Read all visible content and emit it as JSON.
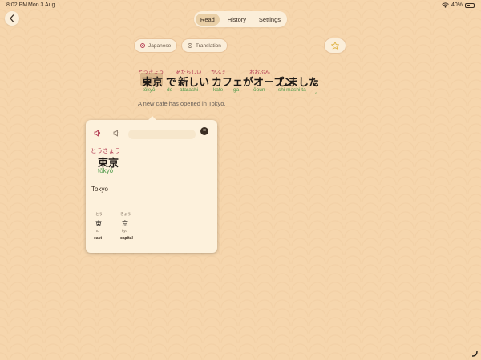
{
  "status_bar": {
    "time": "8:02 PM",
    "date": "Mon 3 Aug",
    "battery": "40%"
  },
  "nav": {
    "tabs": [
      {
        "label": "Read",
        "active": true
      },
      {
        "label": "History",
        "active": false
      },
      {
        "label": "Settings",
        "active": false
      }
    ]
  },
  "toggles": {
    "japanese_label": "Japanese",
    "translation_label": "Translation"
  },
  "sentence": {
    "words": [
      {
        "furigana": "とうきょう",
        "text": "東京",
        "romaji": "tōkyō",
        "selected": true
      },
      {
        "furigana": "",
        "text": "で",
        "romaji": "de"
      },
      {
        "furigana": "あたらしい",
        "text": "新しい",
        "romaji": "atarashi"
      },
      {
        "furigana": "かふぇ",
        "text": "カフェ",
        "romaji": "kafe"
      },
      {
        "furigana": "",
        "text": "が",
        "romaji": "ga"
      },
      {
        "furigana": "おおぷん",
        "text": "オープン",
        "romaji": "ōpun"
      },
      {
        "furigana": "",
        "text": "しました",
        "romaji": "shi mashi ta"
      },
      {
        "furigana": "",
        "text": "。",
        "romaji": "。"
      }
    ],
    "translation": "A new cafe has opened in Tokyo."
  },
  "popover": {
    "furigana": "とうきょう",
    "word": "東京",
    "romaji": "tōkyō",
    "meaning": "Tokyo",
    "kanji": [
      {
        "furigana": "とう",
        "char": "東",
        "romaji": "tō",
        "meaning": "east"
      },
      {
        "furigana": "きょう",
        "char": "京",
        "romaji": "kyō",
        "meaning": "capital"
      }
    ]
  },
  "colors": {
    "background": "#f6d6ad",
    "furigana": "#b33b52",
    "romaji": "#4e9a4a",
    "highlight": "#d9b78c"
  },
  "icons": [
    "chevron-left-icon",
    "speaker-icon",
    "slow-speaker-icon",
    "close-icon",
    "star-icon",
    "wifi-icon",
    "battery-icon"
  ]
}
